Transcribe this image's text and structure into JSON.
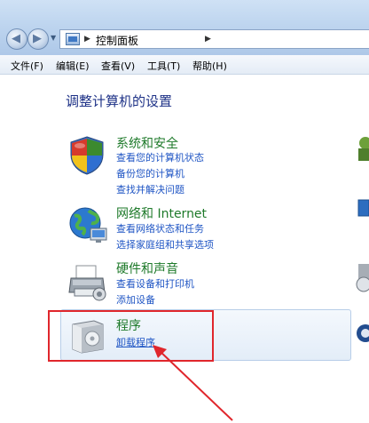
{
  "window": {
    "breadcrumb": "控制面板"
  },
  "menu": {
    "file": "文件(F)",
    "edit": "编辑(E)",
    "view": "查看(V)",
    "tools": "工具(T)",
    "help": "帮助(H)"
  },
  "page": {
    "title": "调整计算机的设置"
  },
  "categories": [
    {
      "title": "系统和安全",
      "icon": "shield-icon",
      "links": [
        "查看您的计算机状态",
        "备份您的计算机",
        "查找并解决问题"
      ]
    },
    {
      "title": "网络和 Internet",
      "icon": "globe-network-icon",
      "links": [
        "查看网络状态和任务",
        "选择家庭组和共享选项"
      ]
    },
    {
      "title": "硬件和声音",
      "icon": "printer-icon",
      "links": [
        "查看设备和打印机",
        "添加设备"
      ]
    },
    {
      "title": "程序",
      "icon": "program-box-icon",
      "links": [
        "卸载程序"
      ]
    }
  ],
  "colors": {
    "category_title": "#1e7a2a",
    "link": "#1f55c4",
    "page_title": "#1e3287",
    "annotation": "#e0262c"
  }
}
